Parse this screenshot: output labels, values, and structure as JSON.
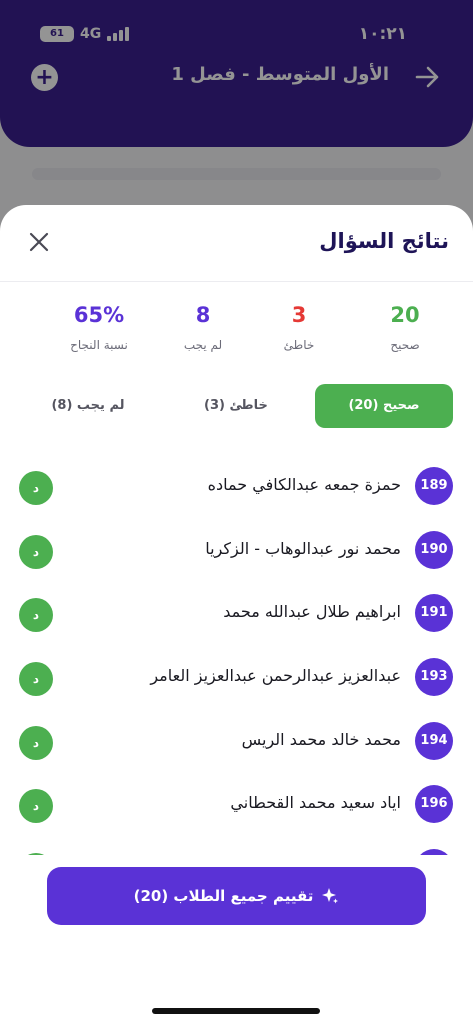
{
  "status_bar": {
    "time": "١٠:٢١",
    "battery_level": "61",
    "network": "4G"
  },
  "background_header": {
    "title": "الأول المتوسط - فصل 1",
    "plus_glyph": "+"
  },
  "sheet": {
    "title": "نتائج السؤال",
    "stats": [
      {
        "value": "20",
        "label": "صحيح",
        "color": "#4caf50"
      },
      {
        "value": "3",
        "label": "خاطئ",
        "color": "#e53935"
      },
      {
        "value": "8",
        "label": "لم يجب",
        "color": "#5a32d6"
      },
      {
        "value": "65%",
        "label": "نسبة النجاح",
        "color": "#5a32d6"
      }
    ],
    "tabs": [
      {
        "label": "صحيح (20)",
        "active": true
      },
      {
        "label": "خاطئ (3)",
        "active": false
      },
      {
        "label": "لم يجب (8)",
        "active": false
      }
    ],
    "students": [
      {
        "number": "189",
        "name": "حمزة جمعه عبدالكافي حماده",
        "grade": "د"
      },
      {
        "number": "190",
        "name": "محمد نور عبدالوهاب - الزكريا",
        "grade": "د"
      },
      {
        "number": "191",
        "name": "ابراهيم طلال عبدالله محمد",
        "grade": "د"
      },
      {
        "number": "193",
        "name": "عبدالعزيز عبدالرحمن عبدالعزيز العامر",
        "grade": "د"
      },
      {
        "number": "194",
        "name": "محمد خالد محمد الريس",
        "grade": "د"
      },
      {
        "number": "196",
        "name": "اياد سعيد محمد القحطاني",
        "grade": "د"
      }
    ],
    "grade_all_button": "تقييم جميع الطلاب (20)"
  },
  "colors": {
    "header_purple": "#3b1f8f",
    "accent_purple": "#5a32d6",
    "success_green": "#4caf50",
    "error_red": "#e53935"
  }
}
